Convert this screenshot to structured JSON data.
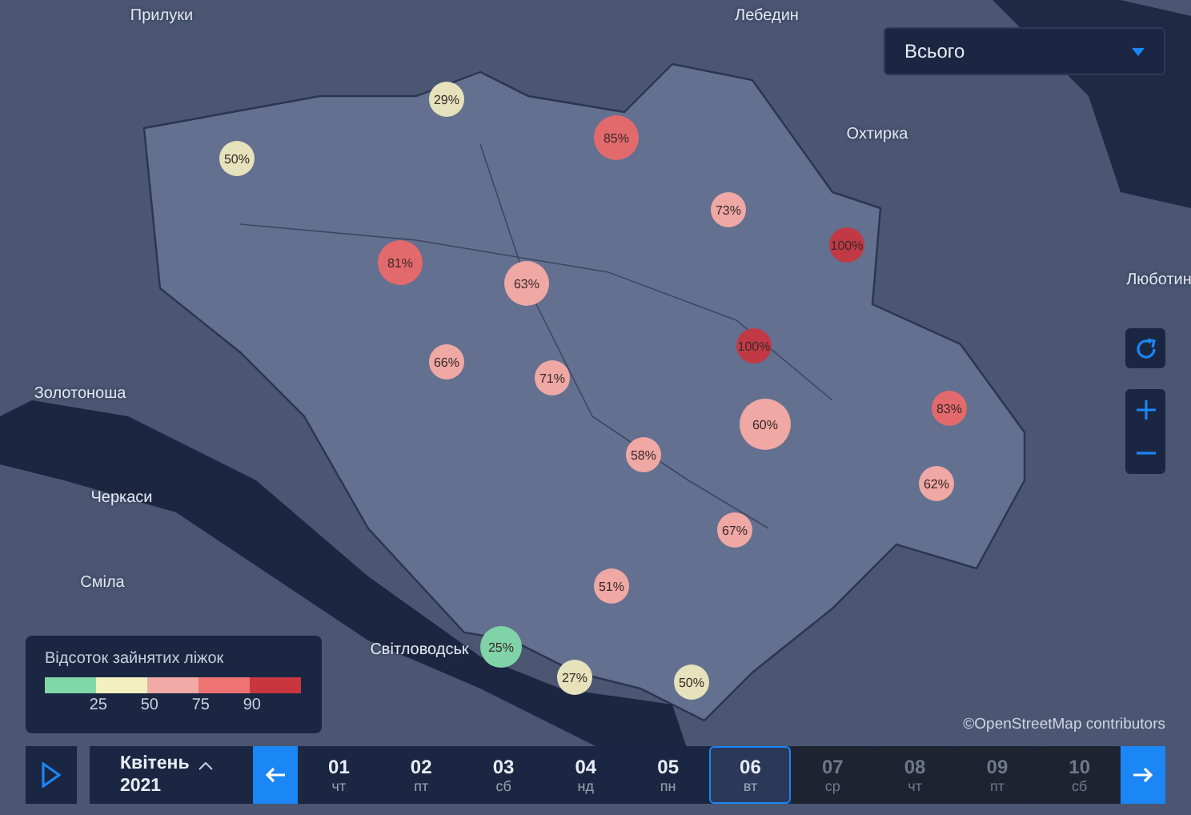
{
  "region_select": {
    "value": "Всього"
  },
  "city_labels": [
    "Прилуки",
    "Лебедин",
    "Охтирка",
    "Люботин",
    "Золотоноша",
    "Черкаси",
    "Сміла",
    "Світловодськ"
  ],
  "markers": [
    {
      "label": "50%",
      "color": "#e6e2bb"
    },
    {
      "label": "29%",
      "color": "#e6e2bb"
    },
    {
      "label": "85%",
      "color": "#e36a6c"
    },
    {
      "label": "73%",
      "color": "#efa8a4"
    },
    {
      "label": "100%",
      "color": "#c23946"
    },
    {
      "label": "81%",
      "color": "#e36a6c"
    },
    {
      "label": "63%",
      "color": "#efa8a4"
    },
    {
      "label": "66%",
      "color": "#efa8a4"
    },
    {
      "label": "71%",
      "color": "#efa8a4"
    },
    {
      "label": "100%",
      "color": "#c23946"
    },
    {
      "label": "60%",
      "color": "#efa8a4"
    },
    {
      "label": "83%",
      "color": "#e36a6c"
    },
    {
      "label": "58%",
      "color": "#efa8a4"
    },
    {
      "label": "62%",
      "color": "#efa8a4"
    },
    {
      "label": "67%",
      "color": "#efa8a4"
    },
    {
      "label": "51%",
      "color": "#efa8a4"
    },
    {
      "label": "25%",
      "color": "#7fd3a6"
    },
    {
      "label": "27%",
      "color": "#e6e2bb"
    },
    {
      "label": "50%",
      "color": "#e6e2bb"
    }
  ],
  "legend": {
    "title": "Відсоток зайнятих ліжок",
    "scale": [
      {
        "color": "#7fd8a8"
      },
      {
        "color": "#f3f0c0"
      },
      {
        "color": "#f2aaa6"
      },
      {
        "color": "#ee7373"
      },
      {
        "color": "#c9363f"
      }
    ],
    "ticks": [
      "25",
      "50",
      "75",
      "90"
    ]
  },
  "attribution": "©OpenStreetMap contributors",
  "timeline": {
    "month": "Квітень",
    "year": "2021",
    "days": [
      {
        "date": "01",
        "weekday": "чт",
        "selected": false,
        "disabled": false
      },
      {
        "date": "02",
        "weekday": "пт",
        "selected": false,
        "disabled": false
      },
      {
        "date": "03",
        "weekday": "сб",
        "selected": false,
        "disabled": false
      },
      {
        "date": "04",
        "weekday": "нд",
        "selected": false,
        "disabled": false
      },
      {
        "date": "05",
        "weekday": "пн",
        "selected": false,
        "disabled": false
      },
      {
        "date": "06",
        "weekday": "вт",
        "selected": true,
        "disabled": false
      },
      {
        "date": "07",
        "weekday": "ср",
        "selected": false,
        "disabled": true
      },
      {
        "date": "08",
        "weekday": "чт",
        "selected": false,
        "disabled": true
      },
      {
        "date": "09",
        "weekday": "пт",
        "selected": false,
        "disabled": true
      },
      {
        "date": "10",
        "weekday": "сб",
        "selected": false,
        "disabled": true
      }
    ]
  }
}
